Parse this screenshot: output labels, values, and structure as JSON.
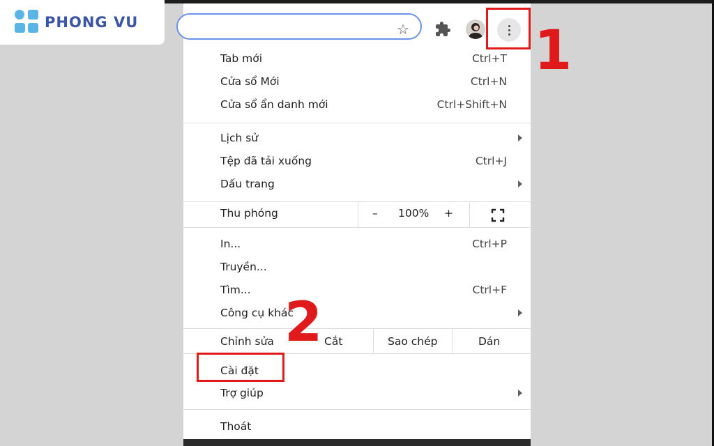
{
  "brand": {
    "name": "PHONG VU",
    "color": "#3b56a6"
  },
  "annotations": {
    "step1": "1",
    "step2": "2",
    "color": "#e0191b"
  },
  "toolbar": {
    "bookmark_icon": "star-icon",
    "extensions_icon": "puzzle-icon",
    "menu_icon": "three-dots-vertical-icon"
  },
  "menu": {
    "new_tab": {
      "label": "Tab mới",
      "shortcut": "Ctrl+T"
    },
    "new_window": {
      "label": "Cửa sổ Mới",
      "shortcut": "Ctrl+N"
    },
    "incognito": {
      "label": "Cửa sổ ẩn danh mới",
      "shortcut": "Ctrl+Shift+N"
    },
    "history": {
      "label": "Lịch sử"
    },
    "downloads": {
      "label": "Tệp đã tải xuống",
      "shortcut": "Ctrl+J"
    },
    "bookmarks": {
      "label": "Dấu trang"
    },
    "zoom": {
      "label": "Thu phóng",
      "minus": "–",
      "value": "100%",
      "plus": "+"
    },
    "print": {
      "label": "In...",
      "shortcut": "Ctrl+P"
    },
    "cast": {
      "label": "Truyền..."
    },
    "find": {
      "label": "Tìm...",
      "shortcut": "Ctrl+F"
    },
    "more_tools": {
      "label": "Công cụ khác"
    },
    "edit": {
      "label": "Chỉnh sửa",
      "cut": "Cắt",
      "copy": "Sao chép",
      "paste": "Dán"
    },
    "settings": {
      "label": "Cài đặt"
    },
    "help": {
      "label": "Trợ giúp"
    },
    "exit": {
      "label": "Thoát"
    }
  }
}
